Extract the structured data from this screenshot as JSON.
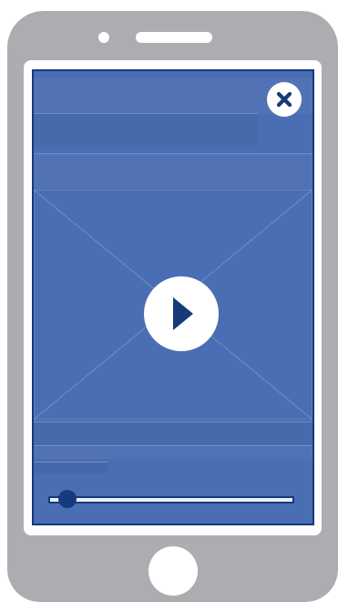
{
  "device": {
    "type": "smartphone"
  },
  "player": {
    "close_icon": "close-icon",
    "play_icon": "play-icon",
    "progress_fraction": 0.07
  },
  "colors": {
    "screen": "#4a6eb4",
    "accent": "#163a7a",
    "shell": "#adadb1",
    "button": "#ffffff"
  }
}
